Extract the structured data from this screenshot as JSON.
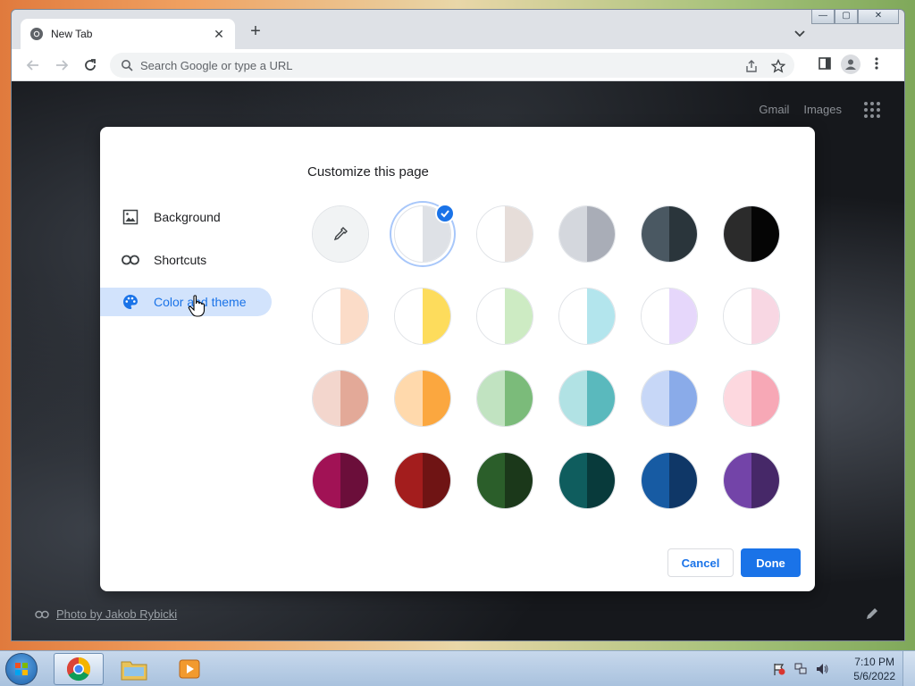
{
  "browser": {
    "tab_title": "New Tab",
    "new_tab_symbol": "+",
    "tab_close_symbol": "✕",
    "omnibox_placeholder": "Search Google or type a URL"
  },
  "window_controls": {
    "minimize": "—",
    "maximize": "▢",
    "close": "✕"
  },
  "ntp": {
    "gmail_label": "Gmail",
    "images_label": "Images",
    "photo_credit": "Photo by Jakob Rybicki"
  },
  "dialog": {
    "title": "Customize this page",
    "sidebar": [
      {
        "label": "Background",
        "icon": "image-icon"
      },
      {
        "label": "Shortcuts",
        "icon": "link-icon"
      },
      {
        "label": "Color and theme",
        "icon": "palette-icon",
        "active": true
      }
    ],
    "cancel_label": "Cancel",
    "done_label": "Done",
    "selected_swatch": "default",
    "swatches": [
      {
        "name": "custom-color",
        "left": "#f1f3f4",
        "right": "#f1f3f4",
        "eyedropper": true
      },
      {
        "name": "default",
        "left": "#ffffff",
        "right": "#dee1e6"
      },
      {
        "name": "warm-grey",
        "left": "#ffffff",
        "right": "#e6ddd9"
      },
      {
        "name": "cool-grey",
        "left": "#d4d7dd",
        "right": "#a9adb7"
      },
      {
        "name": "midnight-blue",
        "left": "#4a5862",
        "right": "#2a353b"
      },
      {
        "name": "black",
        "left": "#2b2b2b",
        "right": "#050505"
      },
      {
        "name": "beige-white",
        "left": "#ffffff",
        "right": "#fbdcc8"
      },
      {
        "name": "yellow-white",
        "left": "#ffffff",
        "right": "#fddc5c"
      },
      {
        "name": "green-white",
        "left": "#ffffff",
        "right": "#cdebc3"
      },
      {
        "name": "light-teal-white",
        "left": "#ffffff",
        "right": "#b3e5ed"
      },
      {
        "name": "light-purple-white",
        "left": "#ffffff",
        "right": "#e6d7fb"
      },
      {
        "name": "pink-white",
        "left": "#ffffff",
        "right": "#f8d7e3"
      },
      {
        "name": "beige",
        "left": "#f3d6cd",
        "right": "#e3a998"
      },
      {
        "name": "orange",
        "left": "#ffd9ac",
        "right": "#fba73f"
      },
      {
        "name": "light-green",
        "left": "#c1e3c1",
        "right": "#7bbb7a"
      },
      {
        "name": "light-teal",
        "left": "#b1e2e4",
        "right": "#5ab9bd"
      },
      {
        "name": "light-blue",
        "left": "#c7d7f7",
        "right": "#8aabe9"
      },
      {
        "name": "pink",
        "left": "#fdd8df",
        "right": "#f7a8b6"
      },
      {
        "name": "dark-pink-red",
        "left": "#a11255",
        "right": "#6b0e3a"
      },
      {
        "name": "dark-red-orange",
        "left": "#a31d1d",
        "right": "#6f1414"
      },
      {
        "name": "dark-green",
        "left": "#2b5e2a",
        "right": "#1b381a"
      },
      {
        "name": "dark-teal",
        "left": "#0f5d5e",
        "right": "#083a3b"
      },
      {
        "name": "dark-blue",
        "left": "#175ba3",
        "right": "#0f3767"
      },
      {
        "name": "purple",
        "left": "#7344a8",
        "right": "#462868"
      }
    ]
  },
  "taskbar": {
    "apps": [
      {
        "name": "chrome",
        "active": true
      },
      {
        "name": "explorer",
        "active": false
      },
      {
        "name": "media-player",
        "active": false
      }
    ],
    "time": "7:10 PM",
    "date": "5/6/2022"
  }
}
